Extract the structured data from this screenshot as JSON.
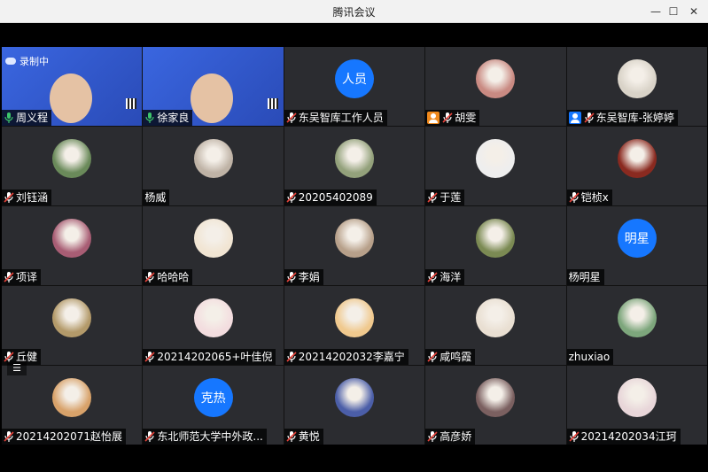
{
  "window": {
    "title": "腾讯会议"
  },
  "recording": {
    "label": "录制中"
  },
  "participants": [
    {
      "name": "周义程",
      "type": "video",
      "mic": "on"
    },
    {
      "name": "徐家良",
      "type": "video",
      "mic": "on"
    },
    {
      "name": "东吴智库工作人员",
      "type": "text",
      "avatar_text": "人员",
      "mic": "muted"
    },
    {
      "name": "胡雯",
      "type": "photo",
      "mic": "muted",
      "badge": "host-orange",
      "avatar_color": "#c98a82"
    },
    {
      "name": "东吴智库-张婷婷",
      "type": "photo",
      "mic": "muted",
      "badge": "host-blue",
      "avatar_color": "#d9d3c8"
    },
    {
      "name": "刘钰涵",
      "type": "photo",
      "mic": "muted",
      "avatar_color": "#6a8a5a"
    },
    {
      "name": "杨威",
      "type": "photo",
      "mic": "none",
      "avatar_color": "#bfb3a6"
    },
    {
      "name": "20205402089",
      "type": "photo",
      "mic": "muted",
      "avatar_color": "#93a17b"
    },
    {
      "name": "于莲",
      "type": "photo",
      "mic": "muted",
      "avatar_color": "#eeeeee"
    },
    {
      "name": "铠桢x",
      "type": "photo",
      "mic": "muted",
      "avatar_color": "#8a2a20"
    },
    {
      "name": "项译",
      "type": "photo",
      "mic": "muted",
      "avatar_color": "#a85d74"
    },
    {
      "name": "哈哈哈",
      "type": "photo",
      "mic": "muted",
      "avatar_color": "#f1e5d3"
    },
    {
      "name": "李娟",
      "type": "photo",
      "mic": "muted",
      "avatar_color": "#b7a08a"
    },
    {
      "name": "海洋",
      "type": "photo",
      "mic": "muted",
      "avatar_color": "#7b8a53"
    },
    {
      "name": "杨明星",
      "type": "text",
      "avatar_text": "明星",
      "mic": "none"
    },
    {
      "name": "丘健",
      "type": "photo",
      "mic": "muted",
      "avatar_color": "#b39a6a"
    },
    {
      "name": "20214202065+叶佳倪",
      "type": "photo",
      "mic": "muted",
      "avatar_color": "#f3dddf"
    },
    {
      "name": "20214202032李嘉宁",
      "type": "photo",
      "mic": "muted",
      "avatar_color": "#f0c98e"
    },
    {
      "name": "咸鸣霞",
      "type": "photo",
      "mic": "muted",
      "avatar_color": "#e9dfd2"
    },
    {
      "name": "zhuxiao",
      "type": "photo",
      "mic": "none",
      "avatar_color": "#7da67c"
    },
    {
      "name": "20214202071赵怡展",
      "type": "photo",
      "mic": "muted",
      "avatar_color": "#d8a26a"
    },
    {
      "name": "东北师范大学中外政...",
      "type": "text",
      "avatar_text": "克热",
      "mic": "muted"
    },
    {
      "name": "黄悦",
      "type": "photo",
      "mic": "muted",
      "avatar_color": "#4b5ea8"
    },
    {
      "name": "高彦娇",
      "type": "photo",
      "mic": "muted",
      "avatar_color": "#7b6060"
    },
    {
      "name": "20214202034江珂",
      "type": "photo",
      "mic": "muted",
      "avatar_color": "#e8d6d9"
    }
  ]
}
